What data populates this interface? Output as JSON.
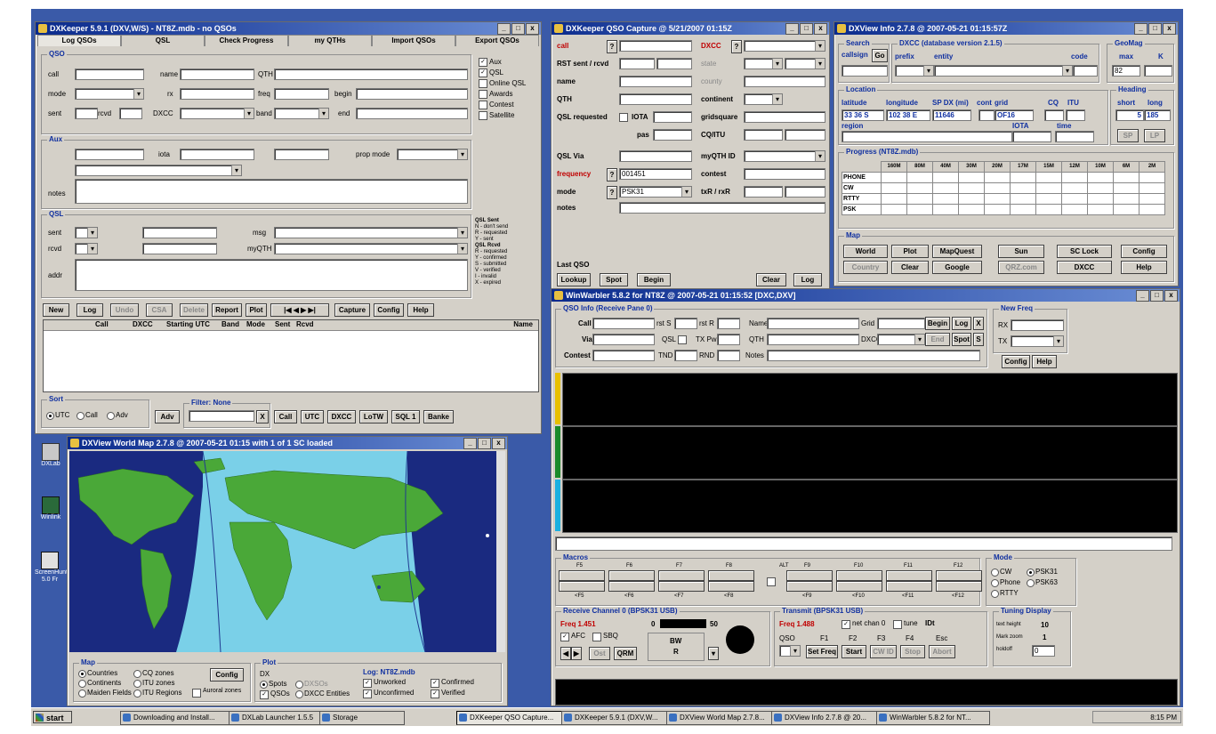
{
  "desktop": {
    "icons": [
      {
        "label": "DXLab"
      },
      {
        "label": "Winlink"
      },
      {
        "label": "ScreenHunter 5.0 Fr"
      }
    ]
  },
  "dxkeeper": {
    "title": "DXKeeper 5.9.1 (DXV,W/S) - NT8Z.mdb - no QSOs",
    "tabs": [
      "Log QSOs",
      "QSL",
      "Check Progress",
      "my QTHs",
      "Import QSOs",
      "Export QSOs"
    ],
    "qso": {
      "group": "QSO",
      "call": "call",
      "name": "name",
      "qth": "QTH",
      "mode": "mode",
      "rx": "rx",
      "freq": "freq",
      "begin": "begin",
      "sent": "sent",
      "rcvd": "rcvd",
      "dxcc": "DXCC",
      "band": "band",
      "end": "end"
    },
    "aux": {
      "group": "Aux",
      "iota": "iota",
      "prop_mode": "prop mode",
      "notes": "notes"
    },
    "qsl": {
      "group": "QSL",
      "sent": "sent",
      "rcvd": "rcvd",
      "qsl_via": "qsl via",
      "addr": "addr",
      "my_qth": "myQTH",
      "msg": "msg"
    },
    "checks": [
      "Aux",
      "QSL",
      "Online QSL",
      "Awards",
      "Contest",
      "Satellite"
    ],
    "qsl_legend": [
      "QSL Sent",
      "N - don't send",
      "R - requested",
      "Y - sent",
      "QSL Rcvd",
      "R - requested",
      "Y - confirmed",
      "S - submitted",
      "V - verified",
      "I - invalid",
      "X - expired"
    ],
    "buttons": [
      "New",
      "Log",
      "Undo",
      "CSA",
      "Delete",
      "Report",
      "Plot",
      "Capture",
      "Config",
      "Help"
    ],
    "nav": "|◀ ◀ ▶ ▶|",
    "columns": [
      "Call",
      "DXCC",
      "Starting UTC",
      "Band",
      "Mode",
      "Sent",
      "Rcvd",
      "Name"
    ],
    "sort": {
      "label": "Sort",
      "options": [
        "UTC",
        "Call",
        "Adv"
      ]
    },
    "adv": "Adv",
    "filter": {
      "label": "Filter: None",
      "x": "X"
    },
    "filter_buttons": [
      "Call",
      "UTC",
      "DXCC",
      "LoTW",
      "SQL 1",
      "Banke"
    ]
  },
  "capture": {
    "title": "DXKeeper QSO Capture @ 5/21/2007  01:15Z",
    "labels": {
      "call": "call",
      "rst": "RST sent / rcvd",
      "name": "name",
      "qth": "QTH",
      "qsl_req": "QSL requested",
      "iota": "IOTA",
      "pas": "pas",
      "qsl_via": "QSL Via",
      "frequency": "frequency",
      "mode": "mode",
      "notes": "notes",
      "dxcc": "DXCC",
      "state": "state",
      "county": "county",
      "continent": "continent",
      "grid": "gridsquare",
      "cq_itu": "CQ/ITU",
      "myqth": "myQTH ID",
      "contest": "contest",
      "txrx": "txR / rxR",
      "last_qso": "Last QSO"
    },
    "freq_value": "001451",
    "mode_value": "PSK31",
    "buttons": [
      "Lookup",
      "Spot",
      "Begin",
      "Clear",
      "Log"
    ]
  },
  "dxview": {
    "title": "DXView Info 2.7.8 @ 2007-05-21 01:15:57Z",
    "search": {
      "label": "Search",
      "callsign": "callsign",
      "go": "Go"
    },
    "dxcc": {
      "label": "DXCC (database version 2.1.5)",
      "prefix": "prefix",
      "entity": "entity",
      "code": "code"
    },
    "geomag": {
      "label": "GeoMag",
      "max": "max",
      "k": "K",
      "val": "82"
    },
    "location": {
      "label": "Location",
      "lat": "latitude",
      "lon": "longitude",
      "sp": "SP DX (mi)",
      "cont": "cont",
      "grid": "grid",
      "cq": "CQ",
      "itu": "ITU",
      "lat_v": "33 36 S",
      "lon_v": "102 38 E",
      "sp_v": "11646",
      "grid_v": "OF16",
      "region": "region",
      "iota": "IOTA",
      "time": "time"
    },
    "heading": {
      "label": "Heading",
      "short": "short",
      "long": "long",
      "short_v": "5",
      "long_v": "185",
      "sp": "SP",
      "lp": "LP"
    },
    "progress": {
      "label": "Progress (NT8Z.mdb)",
      "bands": [
        "160M",
        "80M",
        "40M",
        "30M",
        "20M",
        "17M",
        "15M",
        "12M",
        "10M",
        "6M",
        "2M"
      ],
      "modes": [
        "PHONE",
        "CW",
        "RTTY",
        "PSK"
      ]
    },
    "map": {
      "label": "Map",
      "buttons_row1": [
        "World",
        "Plot",
        "MapQuest",
        "Sun",
        "SC Lock",
        "Config"
      ],
      "buttons_row2": [
        "Country",
        "Clear",
        "Google",
        "QRZ.com",
        "DXCC",
        "Help"
      ]
    }
  },
  "worldmap": {
    "title": "DXView World Map 2.7.8 @ 2007-05-21 01:15 with 1 of 1 SC loaded",
    "map_group": {
      "label": "Map",
      "options": [
        "Countries",
        "CQ zones",
        "Continents",
        "ITU zones",
        "Maiden Fields",
        "ITU Regions"
      ],
      "config": "Config",
      "auroral": "Auroral zones"
    },
    "plot_group": {
      "label": "Plot",
      "dx": "DX",
      "spots": "Spots",
      "qsos": "QSOs",
      "dxcc_entities": "DXCC Entities",
      "dxsos": "DXSOs"
    },
    "log_group": {
      "label": "Log: NT8Z.mdb",
      "items": [
        "Unworked",
        "Confirmed",
        "Unconfirmed",
        "Verified"
      ]
    }
  },
  "winwarbler": {
    "title": "WinWarbler 5.8.2 for NT8Z @ 2007-05-21  01:15:52 [DXC,DXV]",
    "qso_info": {
      "label": "QSO Info (Receive Pane 0)",
      "call": "Call",
      "rst_s": "rst S",
      "rst_r": "rst R",
      "name": "Name",
      "grid": "Grid",
      "begin": "Begin",
      "log": "Log",
      "x": "X",
      "via": "Via",
      "qsl": "QSL",
      "txpwr": "TX Pwr",
      "qth": "QTH",
      "dxcc": "DXCC",
      "end": "End",
      "spot": "Spot",
      "s": "S",
      "contest": "Contest",
      "tnd": "TND",
      "rnd": "RND",
      "notes": "Notes"
    },
    "new_freq": {
      "label": "New Freq",
      "rx": "RX",
      "tx": "TX"
    },
    "config": "Config",
    "help": "Help",
    "macros": {
      "label": "Macros",
      "top": [
        "F5",
        "F6",
        "F7",
        "F8",
        "ALT",
        "F9",
        "F10",
        "F11",
        "F12"
      ],
      "bottom": [
        "<F5",
        "<F6",
        "<F7",
        "<F8",
        "<F9",
        "<F10",
        "<F11",
        "<F12"
      ]
    },
    "mode": {
      "label": "Mode",
      "options": [
        "CW",
        "PSK31",
        "Phone",
        "PSK63",
        "RTTY"
      ]
    },
    "rx_channel": {
      "label": "Receive Channel 0 (BPSK31 USB)",
      "freq": "Freq 1.451",
      "zero": "0",
      "level": "50",
      "afc": "AFC",
      "sbq": "SBQ",
      "ost": "Ost",
      "qrm": "QRM",
      "bw": "BW",
      "bw_val": "R"
    },
    "tx_channel": {
      "label": "Transmit (BPSK31 USB)",
      "freq": "Freq 1.488",
      "net": "net chan 0",
      "tune": "tune",
      "idx": "IDt",
      "qso": "QSO",
      "f1": "F1",
      "f2": "F2",
      "f3": "F3",
      "f4": "F4",
      "esc": "Esc",
      "buttons": [
        "Set Freq",
        "Start",
        "CW ID",
        "Stop",
        "Abort"
      ]
    },
    "tuning": {
      "label": "Tuning Display",
      "text_height": "text height",
      "text_val": "10",
      "mark_zoom": "Mark zoom",
      "mark_val": "1",
      "holdoff": "holdoff",
      "hold_val": "0"
    }
  },
  "taskbar": {
    "start": "start",
    "items": [
      "Downloading and Install...",
      "DXLab Launcher 1.5.5",
      "Storage",
      "DXKeeper QSO Capture...",
      "DXKeeper 5.9.1 (DXV,W...",
      "DXView World Map 2.7.8...",
      "DXView Info 2.7.8 @ 20...",
      "WinWarbler 5.8.2 for NT..."
    ],
    "clock": "8:15 PM"
  },
  "colors": {
    "desktop": "#3a5aa8",
    "titlebar": "#0a2a8c",
    "ocean": "#7ad0e8",
    "land": "#4aa838"
  }
}
